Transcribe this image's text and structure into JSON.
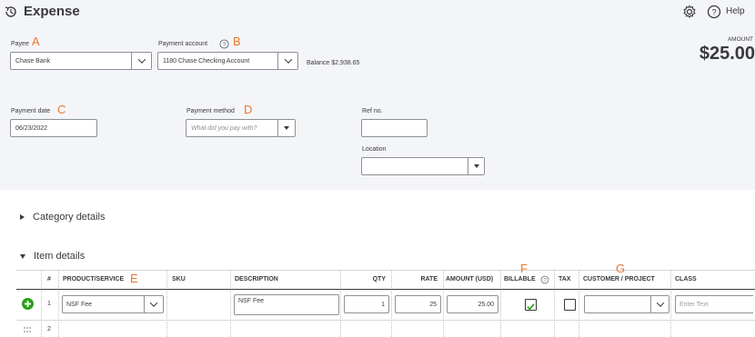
{
  "header": {
    "title": "Expense",
    "help_label": "Help"
  },
  "payee": {
    "label": "Payee",
    "marker": "A",
    "value": "Chase Bank"
  },
  "payment_account": {
    "label": "Payment account",
    "marker": "B",
    "value": "1180 Chase Checking Account",
    "balance_label": "Balance",
    "balance_value": "$2,938.65"
  },
  "amount": {
    "label": "AMOUNT",
    "value": "$25.00"
  },
  "payment_date": {
    "label": "Payment date",
    "marker": "C",
    "value": "06/23/2022"
  },
  "payment_method": {
    "label": "Payment method",
    "marker": "D",
    "placeholder": "What did you pay with?"
  },
  "ref_no": {
    "label": "Ref no.",
    "value": ""
  },
  "location": {
    "label": "Location",
    "value": ""
  },
  "sections": {
    "category_details": "Category details",
    "item_details": "Item details"
  },
  "table": {
    "headers": [
      "#",
      "PRODUCT/SERVICE",
      "SKU",
      "DESCRIPTION",
      "QTY",
      "RATE",
      "AMOUNT (USD)",
      "BILLABLE",
      "TAX",
      "CUSTOMER / PROJECT",
      "CLASS"
    ],
    "markers": {
      "product": "E",
      "billable": "F",
      "customer": "G"
    },
    "rows": [
      {
        "num": "1",
        "product": "NSF Fee",
        "sku": "",
        "description": "NSF Fee",
        "qty": "1",
        "rate": "25",
        "amount": "25.00",
        "billable": true,
        "tax": false,
        "customer": "",
        "class_placeholder": "Enter Text"
      },
      {
        "num": "2"
      }
    ]
  },
  "colors": {
    "accent": "#e8782a",
    "add_green": "#2ca01c",
    "panel_bg": "#f4f5f8"
  }
}
